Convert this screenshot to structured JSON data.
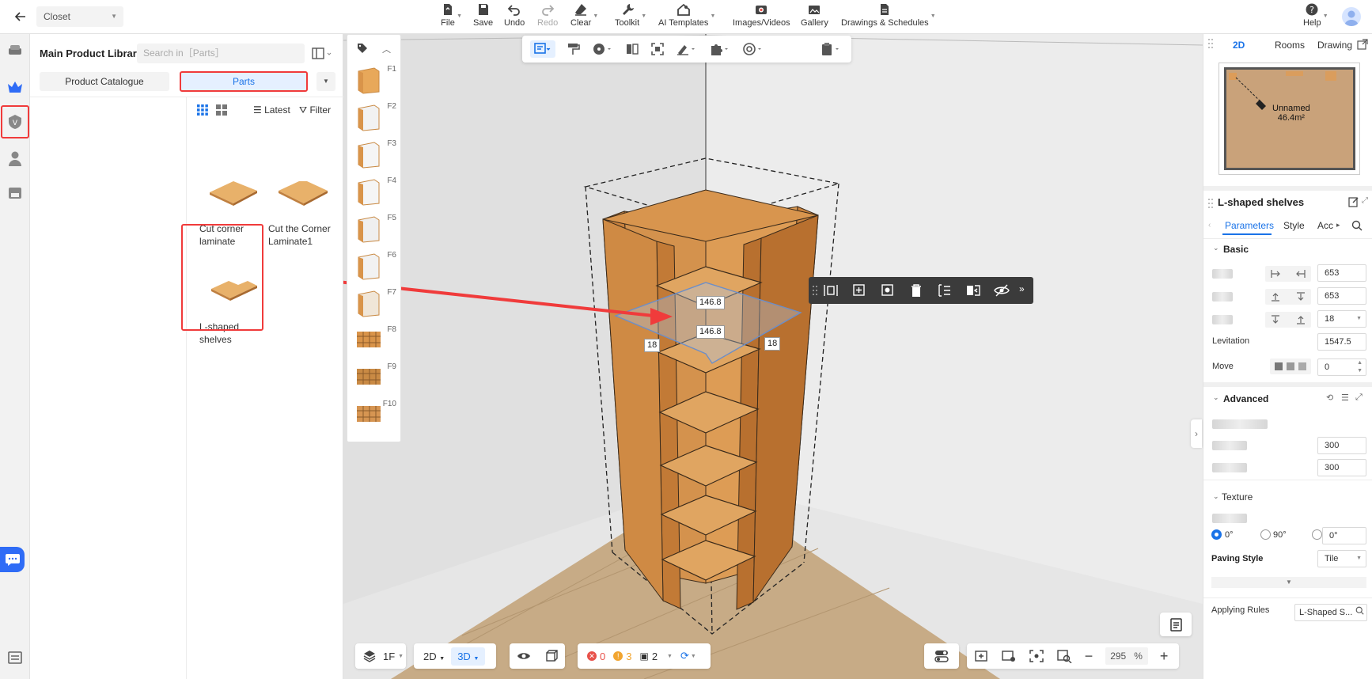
{
  "topbar": {
    "design_name": "Closet",
    "tools": [
      {
        "label": "File"
      },
      {
        "label": "Save"
      },
      {
        "label": "Undo"
      },
      {
        "label": "Redo"
      },
      {
        "label": "Clear"
      },
      {
        "label": "Toolkit"
      },
      {
        "label": "AI Templates"
      },
      {
        "label": "Images/Videos"
      },
      {
        "label": "Gallery"
      },
      {
        "label": "Drawings & Schedules"
      }
    ],
    "help_label": "Help"
  },
  "library": {
    "title": "Main Product Library",
    "search_placeholder": "Search in［Parts］",
    "tabs": {
      "catalogue": "Product Catalogue",
      "parts": "Parts"
    },
    "sort_label": "Latest",
    "filter_label": "Filter",
    "products": [
      {
        "name_line1": "Cut corner",
        "name_line2": "laminate"
      },
      {
        "name_line1": "Cut the Corner",
        "name_line2": "Laminate1"
      },
      {
        "name_line1": "L-shaped",
        "name_line2": "shelves"
      }
    ]
  },
  "strip": {
    "items": [
      "F1",
      "F2",
      "F3",
      "F4",
      "F5",
      "F6",
      "F7",
      "F8",
      "F9",
      "F10"
    ]
  },
  "viewport": {
    "dims": {
      "top1": "146.8",
      "top2": "146.8",
      "left": "18",
      "right": "18"
    }
  },
  "right_panel": {
    "tabs": {
      "t2d": "2D",
      "rooms": "Rooms",
      "drawing": "Drawing"
    },
    "minimap": {
      "room_name": "Unnamed",
      "room_area": "46.4m²"
    },
    "object_title": "L-shaped shelves",
    "subtabs": {
      "parameters": "Parameters",
      "style": "Style",
      "acc": "Acc"
    },
    "basic": {
      "title": "Basic",
      "width": "653",
      "depth": "653",
      "thickness": "18",
      "levitation_label": "Levitation",
      "levitation": "1547.5",
      "move_label": "Move",
      "move": "0"
    },
    "advanced": {
      "title": "Advanced",
      "value1": "300",
      "value2": "300"
    },
    "texture": {
      "title": "Texture",
      "angles": [
        "0°",
        "90°",
        "0°"
      ],
      "paving_label": "Paving Style",
      "paving_value": "Tile"
    },
    "applying_rules_label": "Applying Rules",
    "applying_rules_value": "L-Shaped S..."
  },
  "bottombar": {
    "floor": "1F",
    "mode_2d": "2D",
    "mode_3d": "3D",
    "errors": "0",
    "warnings": "3",
    "count": "2",
    "zoom": "295",
    "zoom_unit": "%"
  },
  "colors": {
    "accent": "#1a73e8",
    "highlight": "#f03b3b",
    "wood": "#d9944a"
  }
}
